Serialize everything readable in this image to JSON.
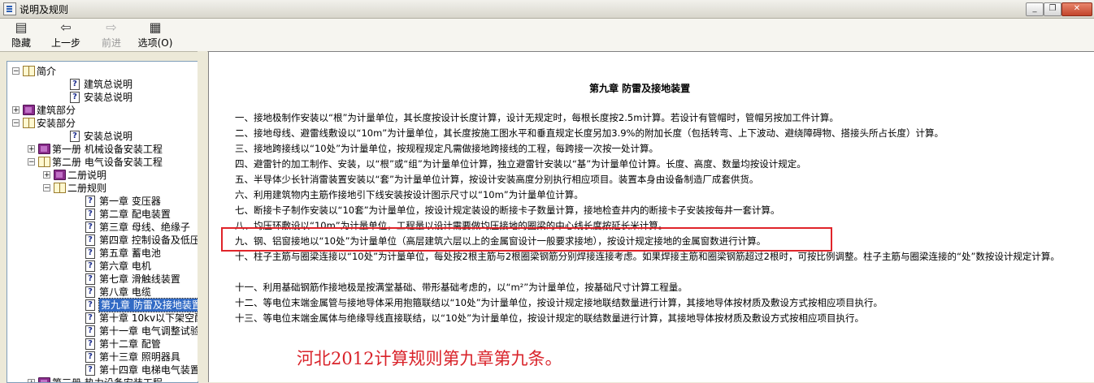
{
  "window": {
    "title": "说明及规则",
    "buttons": [
      "_",
      "❐",
      "✕"
    ]
  },
  "toolbar": {
    "items": [
      {
        "label": "隐藏",
        "icon": "hide-icon",
        "enabled": true
      },
      {
        "label": "上一步",
        "icon": "back-arrow-icon",
        "enabled": true
      },
      {
        "label": "前进",
        "icon": "forward-arrow-icon",
        "enabled": false
      },
      {
        "label": "选项(O)",
        "icon": "options-icon",
        "enabled": true
      }
    ]
  },
  "tree": {
    "items": [
      {
        "label": "简介",
        "icon": "book-open-icon",
        "exp": "⊟"
      },
      {
        "label": "建筑总说明",
        "icon": "help-page-icon",
        "exp": ""
      },
      {
        "label": "安装总说明",
        "icon": "help-page-icon",
        "exp": ""
      },
      {
        "label": "建筑部分",
        "icon": "book-closed-icon",
        "exp": "⊞"
      },
      {
        "label": "安装部分",
        "icon": "book-open-icon",
        "exp": "⊟"
      },
      {
        "label": "安装总说明",
        "icon": "help-page-icon",
        "exp": ""
      },
      {
        "label": "第一册 机械设备安装工程",
        "icon": "book-closed-icon",
        "exp": "⊞"
      },
      {
        "label": "第二册 电气设备安装工程",
        "icon": "book-open-icon",
        "exp": "⊟"
      },
      {
        "label": "二册说明",
        "icon": "book-closed-icon",
        "exp": "⊞"
      },
      {
        "label": "二册规则",
        "icon": "book-open-icon",
        "exp": "⊟"
      },
      {
        "label": "第一章 变压器",
        "icon": "help-page-icon",
        "exp": ""
      },
      {
        "label": "第二章 配电装置",
        "icon": "help-page-icon",
        "exp": ""
      },
      {
        "label": "第三章 母线、绝缘子",
        "icon": "help-page-icon",
        "exp": ""
      },
      {
        "label": "第四章 控制设备及低压电",
        "icon": "help-page-icon",
        "exp": ""
      },
      {
        "label": "第五章 蓄电池",
        "icon": "help-page-icon",
        "exp": ""
      },
      {
        "label": "第六章 电机",
        "icon": "help-page-icon",
        "exp": ""
      },
      {
        "label": "第七章 滑触线装置",
        "icon": "help-page-icon",
        "exp": ""
      },
      {
        "label": "第八章 电缆",
        "icon": "help-page-icon",
        "exp": ""
      },
      {
        "label": "第九章 防雷及接地装置",
        "icon": "help-page-icon",
        "exp": "",
        "selected": true
      },
      {
        "label": "第十章 10kv以下架空配电",
        "icon": "help-page-icon",
        "exp": ""
      },
      {
        "label": "第十一章 电气调整试验",
        "icon": "help-page-icon",
        "exp": ""
      },
      {
        "label": "第十二章 配管",
        "icon": "help-page-icon",
        "exp": ""
      },
      {
        "label": "第十三章 照明器具",
        "icon": "help-page-icon",
        "exp": ""
      },
      {
        "label": "第十四章 电梯电气装置",
        "icon": "help-page-icon",
        "exp": ""
      },
      {
        "label": "第三册 热力设备安装工程",
        "icon": "book-closed-icon",
        "exp": "⊞"
      }
    ]
  },
  "document": {
    "title": "第九章  防雷及接地装置",
    "paragraphs": [
      "一、接地极制作安装以“根”为计量单位，其长度按设计长度计算，设计无规定时，每根长度按2.5m计算。若设计有管帽时，管帽另按加工件计算。",
      "二、接地母线、避雷线敷设以“10m”为计量单位，其长度按施工图水平和垂直规定长度另加3.9%的附加长度（包括转弯、上下波动、避绕障碍物、搭接头所占长度）计算。",
      "三、接地跨接线以“10处”为计量单位，按规程规定凡需做接地跨接线的工程，每跨接一次按一处计算。",
      "四、避雷针的加工制作、安装，以“根”或“组”为计量单位计算，独立避雷针安装以“基”为计量单位计算。长度、高度、数量均按设计规定。",
      "五、半导体少长针消雷装置安装以“套”为计量单位计算，按设计安装高度分别执行相应项目。装置本身由设备制造厂成套供货。",
      "六、利用建筑物内主筋作接地引下线安装按设计图示尺寸以“10m”为计量单位计算。",
      "七、断接卡子制作安装以“10套”为计量单位，按设计规定装设的断接卡子数量计算，接地检查井内的断接卡子安装按每井一套计算。",
      "八、均压环敷设以“10m”为计量单位，工程量以设计需要做均压接地的圈梁的中心线长度按延长米计算。",
      "九、钢、铝窗接地以“10处”为计量单位（高层建筑六层以上的金属窗设计一般要求接地），按设计规定接地的金属窗数进行计算。",
      "十、柱子主筋与圈梁连接以“10处”为计量单位，每处按2根主筋与2根圈梁钢筋分别焊接连接考虑。如果焊接主筋和圈梁钢筋超过2根时，可按比例调整。柱子主筋与圈梁连接的“处”数按设计规定计算。",
      "十一、利用基础钢筋作接地极是按满堂基础、带形基础考虑的，以“m²”为计量单位，按基础尺寸计算工程量。",
      "十二、等电位末端金属管与接地导体采用抱箍联结以“10处”为计量单位，按设计规定接地联结数量进行计算，其接地导体按材质及敷设方式按相应项目执行。",
      "十三、等电位末端金属体与绝缘导线直接联结，以“10处”为计量单位，按设计规定的联结数量进行计算，其接地导体按材质及敷设方式按相应项目执行。"
    ],
    "annotation": "河北2012计算规则第九章第九条。",
    "colors": {
      "highlight": "#e0242a",
      "annotation": "#d9232a",
      "selection": "#316ac5"
    }
  }
}
